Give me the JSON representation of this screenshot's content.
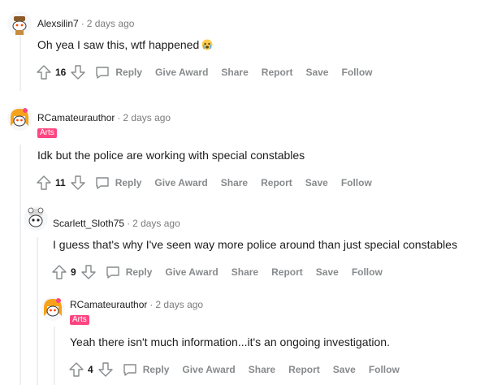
{
  "colors": {
    "flair_bg": "#ff4581",
    "action_gray": "#878a8c",
    "thread_line": "#edeff1"
  },
  "actions": {
    "reply": "Reply",
    "give_award": "Give Award",
    "share": "Share",
    "report": "Report",
    "save": "Save",
    "follow": "Follow"
  },
  "comments": [
    {
      "username": "Alexsilin7",
      "separator": "·",
      "time": "2 days ago",
      "flair": "",
      "text": "Oh yea I saw this, wtf happened",
      "emoji": "crying-face-emoji",
      "score": "16",
      "avatar_icon": "snoo-avatar-icon"
    },
    {
      "username": "RCamateurauthor",
      "separator": "·",
      "time": "2 days ago",
      "flair": "Arts",
      "text": "Idk but the police are working with special constables",
      "score": "11",
      "avatar_icon": "snoo-avatar-icon"
    },
    {
      "username": "Scarlett_Sloth75",
      "separator": "·",
      "time": "2 days ago",
      "flair": "",
      "text": "I guess that's why I've seen way more police around than just special constables",
      "score": "9",
      "avatar_icon": "snoo-avatar-icon"
    },
    {
      "username": "RCamateurauthor",
      "separator": "·",
      "time": "2 days ago",
      "flair": "Arts",
      "text": "Yeah there isn't much information...it's an ongoing investigation.",
      "score": "4",
      "avatar_icon": "snoo-avatar-icon"
    }
  ]
}
